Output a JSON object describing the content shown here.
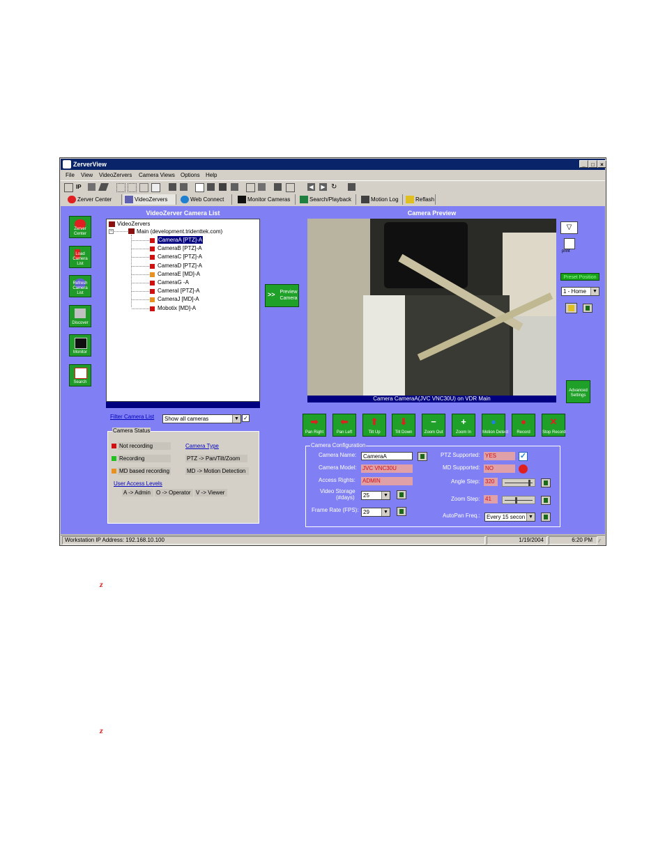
{
  "window": {
    "title": "ZerverView"
  },
  "menu": [
    "File",
    "View",
    "VideoZervers",
    "Camera Views",
    "Options",
    "Help"
  ],
  "tabs": [
    "Zerver Center",
    "VideoZervers",
    "Web Connect",
    "Monitor Cameras",
    "Search/Playback",
    "Motion Log",
    "Reflash"
  ],
  "sidebar": [
    "Zerver Center",
    "Load Camera List",
    "Refresh Camera List",
    "Discover",
    "Monitor",
    "Search"
  ],
  "camera_list": {
    "header": "VideoZerver Camera List",
    "root": "VideoZervers",
    "server": "Main (development.tridenttek.com)",
    "cameras": [
      {
        "label": "CameraA [PTZ]-A",
        "color": "#d01010"
      },
      {
        "label": "CameraB [PTZ]-A",
        "color": "#d01010"
      },
      {
        "label": "CameraC [PTZ]-A",
        "color": "#d01010"
      },
      {
        "label": "CameraD [PTZ]-A",
        "color": "#d01010"
      },
      {
        "label": "CameraE [MD]-A",
        "color": "#e89020"
      },
      {
        "label": "CameraG -A",
        "color": "#d01010"
      },
      {
        "label": "CameraI [PTZ]-A",
        "color": "#d01010"
      },
      {
        "label": "CameraJ [MD]-A",
        "color": "#e89020"
      },
      {
        "label": "Mobotix [MD]-A",
        "color": "#d01010"
      }
    ]
  },
  "preview_button": {
    "arrow": ">>",
    "label": "Preview Camera"
  },
  "filter": {
    "label": "Filter Camera List",
    "value": "Show all cameras"
  },
  "camera_status": {
    "title": "Camera Status",
    "legend": [
      {
        "label": "Not recording",
        "color": "#d01010"
      },
      {
        "label": "Recording",
        "color": "#20c020"
      },
      {
        "label": "MD based recording",
        "color": "#e89020"
      }
    ],
    "type_title": "Camera Type",
    "types": [
      "PTZ -> Pan/Tilt/Zoom",
      "MD -> Motion Detection"
    ],
    "access_title": "User Access Levels",
    "access": [
      "A -> Admin",
      "O -> Operator",
      "V -> Viewer"
    ]
  },
  "preview": {
    "header": "Camera Preview",
    "caption": "Camera CameraA(JVC VNC30U) on VDR Main"
  },
  "right_panel": {
    "print_label": "print",
    "preset_label": "Preset Position",
    "preset_value": "1 - Home",
    "advanced_label": "Advanced Settings"
  },
  "ptz_buttons": [
    "Pan Right",
    "Pan Left",
    "Tilt Up",
    "Tilt Down",
    "Zoom Out",
    "Zoom In",
    "Motion Detect",
    "Record",
    "Stop Record"
  ],
  "config": {
    "title": "Camera Configuration",
    "camera_name_label": "Camera Name:",
    "camera_name": "CameraA",
    "camera_model_label": "Camera Model:",
    "camera_model": "JVC VNC30U",
    "access_rights_label": "Access Rights:",
    "access_rights": "ADMIN",
    "video_storage_label": "Video Storage",
    "video_storage_sub": "(#days)",
    "video_storage": "25",
    "frame_rate_label": "Frame Rate (FPS):",
    "frame_rate": "29",
    "ptz_supported_label": "PTZ Supported:",
    "ptz_supported": "YES",
    "md_supported_label": "MD Supported:",
    "md_supported": "NO",
    "angle_step_label": "Angle Step:",
    "angle_step": "320",
    "angle_slider": 0.9,
    "zoom_step_label": "Zoom Step:",
    "zoom_step": "41",
    "zoom_slider": 0.4,
    "autopan_label": "AutoPan Freq.:",
    "autopan": "Every 15 secon"
  },
  "status_bar": {
    "ip": "Workstation IP Address: 192.168.10.100",
    "date": "1/19/2004",
    "time": "6:20 PM"
  },
  "colors": {
    "panel": "#8080f4",
    "button": "#1fa028",
    "title": "#0a246a"
  }
}
